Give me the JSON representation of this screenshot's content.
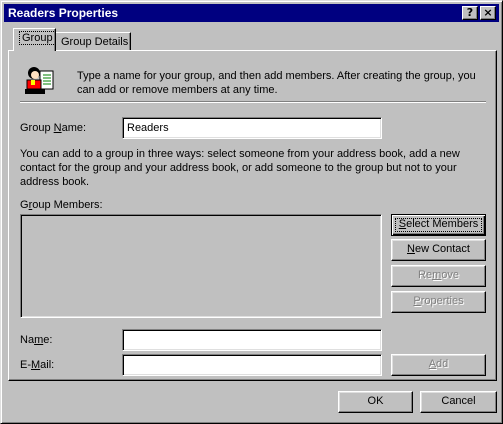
{
  "window": {
    "title": "Readers Properties",
    "help_glyph": "?",
    "close_glyph": "×"
  },
  "tabs": [
    {
      "label": "Group",
      "active": true
    },
    {
      "label": "Group Details",
      "active": false
    }
  ],
  "intro_text": "Type a name for your group, and then add members. After creating the group, you can add or remove members at any time.",
  "group_name": {
    "label_pre": "Group ",
    "label_hot": "N",
    "label_post": "ame:",
    "value": "Readers"
  },
  "description": "You can add to a group in three ways: select someone from your address book, add a new contact for the group and your address book, or add someone to the group but not to your address book.",
  "members": {
    "label_pre": "G",
    "label_hot": "r",
    "label_post": "oup Members:",
    "items": []
  },
  "buttons": {
    "select_members": {
      "pre": "",
      "hot": "S",
      "post": "elect Members"
    },
    "new_contact": {
      "pre": "",
      "hot": "N",
      "post": "ew Contact"
    },
    "remove": {
      "pre": "Re",
      "hot": "m",
      "post": "ove"
    },
    "properties": {
      "pre": "",
      "hot": "P",
      "post": "roperties"
    },
    "add": {
      "pre": "",
      "hot": "A",
      "post": "dd"
    },
    "ok": "OK",
    "cancel": "Cancel"
  },
  "name_field": {
    "label_pre": "Na",
    "label_hot": "m",
    "label_post": "e:",
    "value": ""
  },
  "email_field": {
    "label_pre": "E-",
    "label_hot": "M",
    "label_post": "ail:",
    "value": ""
  },
  "colors": {
    "title_bar": "#000080",
    "face": "#c0c0c0",
    "disabled_text": "#808080"
  },
  "icons": {
    "group": "group-people-icon"
  }
}
